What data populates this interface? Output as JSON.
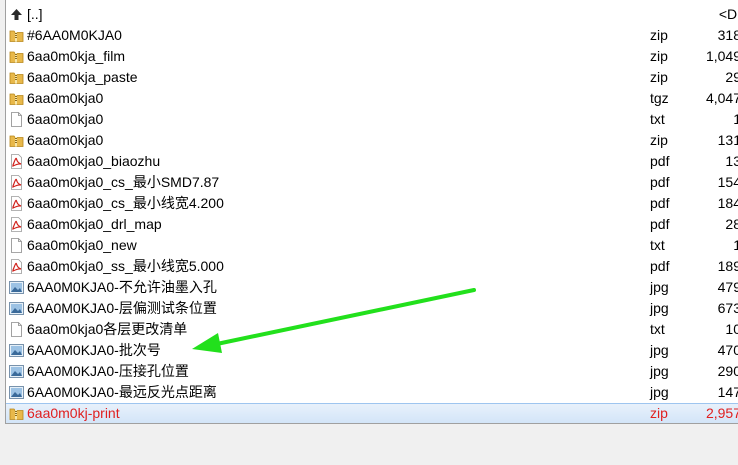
{
  "rows": [
    {
      "icon": "up-folder-icon",
      "name": "[..]",
      "ext": "",
      "size": "<DI"
    },
    {
      "icon": "zip-folder-icon",
      "name": "#6AA0M0KJA0",
      "ext": "zip",
      "size": "318"
    },
    {
      "icon": "zip-folder-icon",
      "name": "6aa0m0kja_film",
      "ext": "zip",
      "size": "1,049"
    },
    {
      "icon": "zip-folder-icon",
      "name": "6aa0m0kja_paste",
      "ext": "zip",
      "size": "29"
    },
    {
      "icon": "zip-folder-icon",
      "name": "6aa0m0kja0",
      "ext": "tgz",
      "size": "4,047"
    },
    {
      "icon": "text-file-icon",
      "name": "6aa0m0kja0",
      "ext": "txt",
      "size": "1"
    },
    {
      "icon": "zip-folder-icon",
      "name": "6aa0m0kja0",
      "ext": "zip",
      "size": "131"
    },
    {
      "icon": "pdf-file-icon",
      "name": "6aa0m0kja0_biaozhu",
      "ext": "pdf",
      "size": "13"
    },
    {
      "icon": "pdf-file-icon",
      "name": "6aa0m0kja0_cs_最小SMD7.87",
      "ext": "pdf",
      "size": "154"
    },
    {
      "icon": "pdf-file-icon",
      "name": "6aa0m0kja0_cs_最小线宽4.200",
      "ext": "pdf",
      "size": "184"
    },
    {
      "icon": "pdf-file-icon",
      "name": "6aa0m0kja0_drl_map",
      "ext": "pdf",
      "size": "28"
    },
    {
      "icon": "text-file-icon",
      "name": "6aa0m0kja0_new",
      "ext": "txt",
      "size": "1"
    },
    {
      "icon": "pdf-file-icon",
      "name": "6aa0m0kja0_ss_最小线宽5.000",
      "ext": "pdf",
      "size": "189"
    },
    {
      "icon": "image-file-icon",
      "name": "6AA0M0KJA0-不允许油墨入孔",
      "ext": "jpg",
      "size": "479"
    },
    {
      "icon": "image-file-icon",
      "name": "6AA0M0KJA0-层偏测试条位置",
      "ext": "jpg",
      "size": "673"
    },
    {
      "icon": "text-file-icon",
      "name": "6aa0m0kja0各层更改清单",
      "ext": "txt",
      "size": "10"
    },
    {
      "icon": "image-file-icon",
      "name": "6AA0M0KJA0-批次号",
      "ext": "jpg",
      "size": "470"
    },
    {
      "icon": "image-file-icon",
      "name": "6AA0M0KJA0-压接孔位置",
      "ext": "jpg",
      "size": "290"
    },
    {
      "icon": "image-file-icon",
      "name": "6AA0M0KJA0-最远反光点距离",
      "ext": "jpg",
      "size": "147"
    },
    {
      "icon": "zip-folder-icon",
      "name": "6aa0m0kj-print",
      "ext": "zip",
      "size": "2,957",
      "selected": true
    }
  ],
  "colors": {
    "selected_text": "#e02020",
    "arrow": "#22e01c"
  }
}
